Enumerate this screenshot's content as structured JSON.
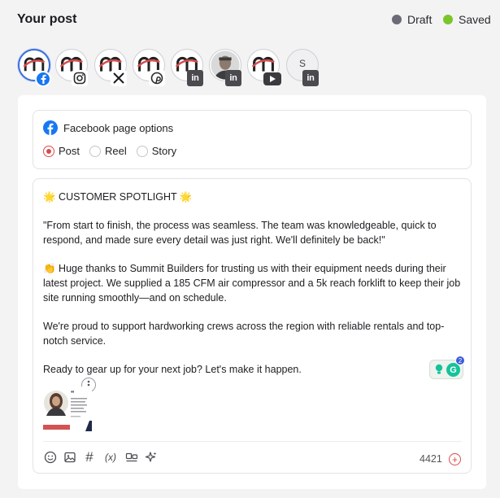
{
  "header": {
    "title": "Your post",
    "legend": [
      {
        "label": "Draft",
        "color": "#6b6b78"
      },
      {
        "label": "Saved",
        "color": "#7ac62a"
      }
    ]
  },
  "accounts": [
    {
      "logo": "m-brand-logo",
      "network": "facebook-icon",
      "selected": true
    },
    {
      "logo": "m-brand-logo",
      "network": "instagram-icon",
      "selected": false
    },
    {
      "logo": "m-brand-logo",
      "network": "x-icon",
      "selected": false
    },
    {
      "logo": "m-brand-logo",
      "network": "pinterest-icon",
      "selected": false
    },
    {
      "logo": "m-brand-logo",
      "network": "linkedin-icon",
      "selected": false
    },
    {
      "logo": "person-photo",
      "network": "linkedin-icon",
      "selected": false
    },
    {
      "logo": "m-brand-logo",
      "network": "youtube-icon",
      "selected": false
    },
    {
      "logo": "S",
      "network": "linkedin-icon",
      "selected": false
    }
  ],
  "linkedin_badge_text": "in",
  "avatar_initial": "S",
  "facebook_options": {
    "title": "Facebook page options",
    "types": [
      {
        "label": "Post",
        "checked": true
      },
      {
        "label": "Reel",
        "checked": false
      },
      {
        "label": "Story",
        "checked": false
      }
    ]
  },
  "post": {
    "paragraphs": [
      "🌟 CUSTOMER SPOTLIGHT 🌟",
      "\"From start to finish, the process was seamless. The team was knowledgeable, quick to respond, and made sure every detail was just right. We'll definitely be back!\"",
      "👏 Huge thanks to Summit Builders for trusting us with their equipment needs during their latest project. We supplied a 185 CFM air compressor and a 5k reach forklift to keep their job site running smoothly—and on schedule.",
      "We're proud to support hardworking crews across the region with reliable rentals and top-notch service.",
      "Ready to gear up for your next job? Let's make it happen."
    ]
  },
  "grammarly": {
    "letter": "G",
    "count": "2"
  },
  "toolbar": {
    "tools": [
      "emoji-icon",
      "image-icon",
      "hashtag-icon",
      "variable-icon",
      "media-library-icon",
      "ai-sparkle-icon"
    ],
    "variable_label": "(x)",
    "hashtag_label": "#",
    "char_count": "4421",
    "add_label": "+"
  },
  "colors": {
    "accent": "#d84b4b",
    "facebook": "#1877f2"
  }
}
